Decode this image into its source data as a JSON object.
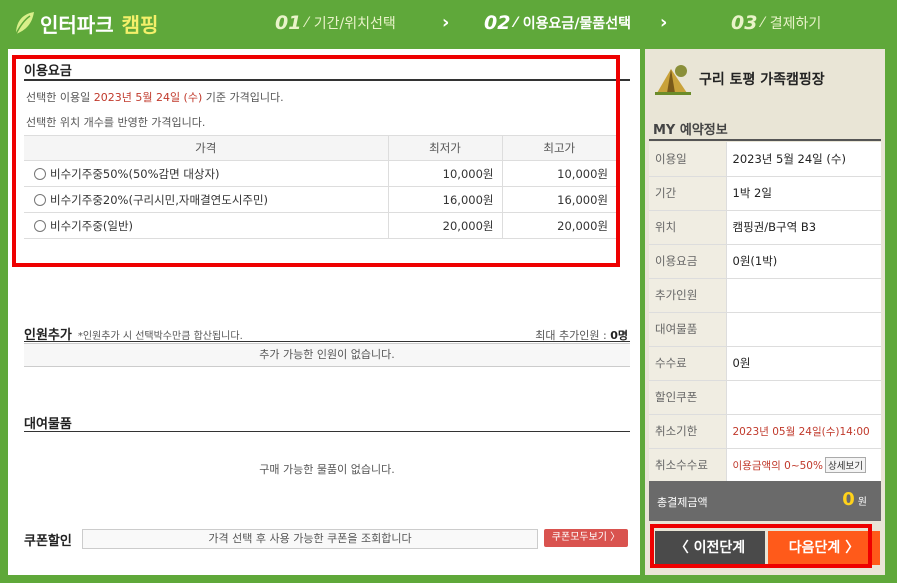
{
  "header": {
    "logo_text": "인터파크",
    "logo_sub": "캠핑",
    "steps": [
      {
        "num": "01",
        "label": "기간/위치선택"
      },
      {
        "num": "02",
        "label": "이용요금/물품선택"
      },
      {
        "num": "03",
        "label": "결제하기"
      }
    ],
    "active_step": 2
  },
  "fees": {
    "title": "이용요금",
    "note1_prefix": "선택한 이용일 ",
    "note1_date": "2023년 5월 24일 (수)",
    "note1_suffix": " 기준 가격입니다.",
    "note2": "선택한 위치 개수를 반영한 가격입니다.",
    "headers": [
      "가격",
      "최저가",
      "최고가"
    ],
    "rows": [
      {
        "name": "비수기주중50%(50%감면 대상자)",
        "min": "10,000원",
        "max": "10,000원"
      },
      {
        "name": "비수기주중20%(구리시민,자매결연도시주민)",
        "min": "16,000원",
        "max": "16,000원"
      },
      {
        "name": "비수기주중(일반)",
        "min": "20,000원",
        "max": "20,000원"
      }
    ]
  },
  "people": {
    "title": "인원추가",
    "note": "*인원추가 시 선택박수만큼 합산됩니다.",
    "max_label": "최대 추가인원 : ",
    "max_value": "0명",
    "empty": "추가 가능한 인원이 없습니다."
  },
  "rental": {
    "title": "대여물품",
    "empty": "구매 가능한 물품이 없습니다."
  },
  "coupon": {
    "title": "쿠폰할인",
    "placeholder": "가격 선택 후 사용 가능한 쿠폰을 조회합니다",
    "button": "쿠폰모두보기 〉"
  },
  "side": {
    "camp_name": "구리 토평 가족캠핑장",
    "myinfo_title": "MY 예약정보",
    "info": [
      {
        "k": "이용일",
        "v": "2023년 5월 24일 (수)"
      },
      {
        "k": "기간",
        "v": "1박 2일"
      },
      {
        "k": "위치",
        "v": "캠핑권/B구역 B3"
      },
      {
        "k": "이용요금",
        "v": "0원(1박)"
      },
      {
        "k": "추가인원",
        "v": ""
      },
      {
        "k": "대여물품",
        "v": ""
      },
      {
        "k": "수수료",
        "v": "0원"
      },
      {
        "k": "할인쿠폰",
        "v": ""
      },
      {
        "k": "취소기한",
        "v": "2023년 05월 24일(수)14:00"
      },
      {
        "k": "취소수수료",
        "v": "이용금액의 0~50%"
      }
    ],
    "detail_btn": "상세보기",
    "total_label": "총결제금액",
    "total_value": "0",
    "total_unit": "원",
    "prev": "〈 이전단계",
    "next": "다음단계 〉"
  },
  "colors": {
    "header_green": "#5fa83a",
    "highlight_red": "#ee0000",
    "next_orange": "#ff5a1a"
  }
}
